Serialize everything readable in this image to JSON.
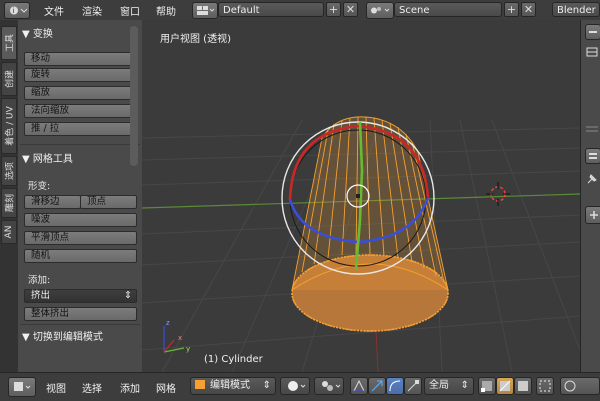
{
  "topbar": {
    "menus": [
      "文件",
      "渲染",
      "窗口",
      "帮助"
    ],
    "layout": "Default",
    "scene": "Scene",
    "engine": "Blender"
  },
  "tabs": [
    "工具",
    "创建",
    "着色 / UV",
    "选项",
    "雕刻",
    "AN"
  ],
  "shelf": {
    "transform": {
      "title": "▼ 变换",
      "buttons": [
        "移动",
        "旋转",
        "缩放",
        "法向缩放",
        "推 / 拉"
      ]
    },
    "mesh_tools": {
      "title": "▼ 网格工具",
      "deform_label": "形变:",
      "slide_edge": "滑移边",
      "vertex": "顶点",
      "noise": "噪波",
      "smooth_vertex": "平滑顶点",
      "random": "随机",
      "add_label": "添加:",
      "extrude": "挤出",
      "extrude_updown": "⇕",
      "extrude_region": "整体挤出"
    },
    "toggle_edit": "▼ 切换到编辑模式"
  },
  "viewport": {
    "title": "用户视图 (透视)",
    "object_label": "(1) Cylinder"
  },
  "bottombar": {
    "menus": [
      "视图",
      "选择",
      "添加",
      "网格"
    ],
    "mode": "编辑模式",
    "pivot": "全局"
  },
  "colors": {
    "selection": "#f5a030",
    "x_axis": "#c82828",
    "y_axis": "#66bb33",
    "z_axis": "#3a4fd8",
    "grid": "#4a4a4a"
  }
}
